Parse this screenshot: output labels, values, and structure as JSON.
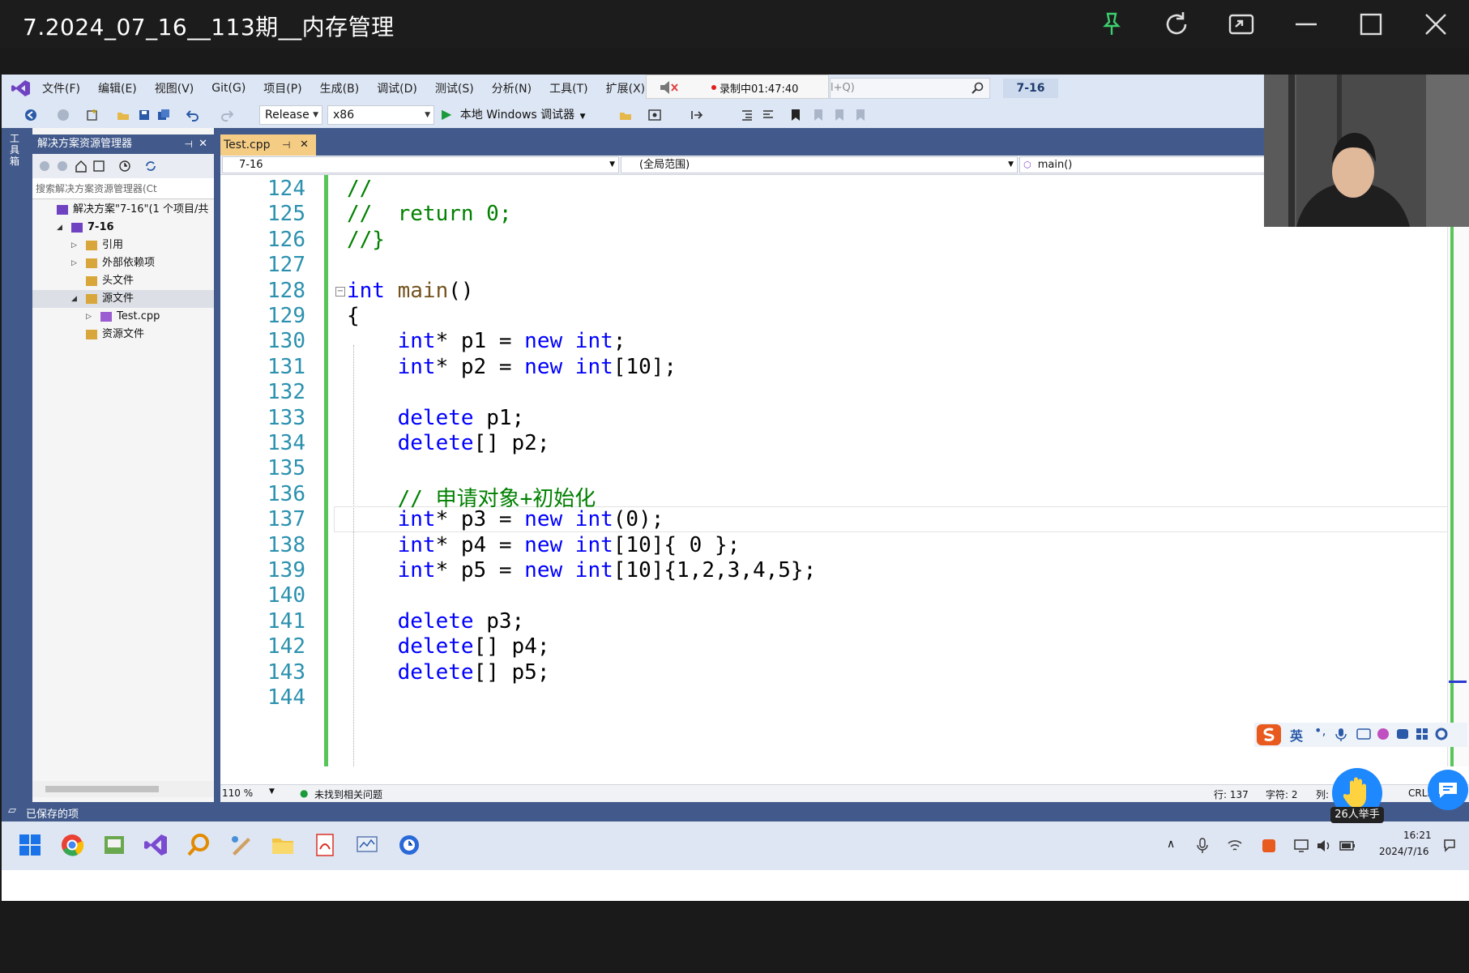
{
  "player": {
    "title": "7.2024_07_16__113期__内存管理"
  },
  "menu": {
    "items": [
      "文件(F)",
      "编辑(E)",
      "视图(V)",
      "Git(G)",
      "项目(P)",
      "生成(B)",
      "调试(D)",
      "测试(S)",
      "分析(N)",
      "工具(T)",
      "扩展(X)"
    ],
    "recording": "录制中01:47:40",
    "search_placeholder": "l+Q)",
    "project_badge": "7-16"
  },
  "toolbar": {
    "config": "Release",
    "platform": "x86",
    "run_label": "本地 Windows 调试器"
  },
  "left_strip": {
    "label": "工具箱"
  },
  "solution": {
    "header": "解决方案资源管理器",
    "search_placeholder": "搜索解决方案资源管理器(Ct",
    "tree": [
      {
        "label": "解决方案\"7-16\"(1 个项目/共",
        "level": 0,
        "expander": ""
      },
      {
        "label": "7-16",
        "level": 1,
        "expander": "◢"
      },
      {
        "label": "引用",
        "level": 2,
        "expander": "▷"
      },
      {
        "label": "外部依赖项",
        "level": 2,
        "expander": "▷"
      },
      {
        "label": "头文件",
        "level": 2,
        "expander": ""
      },
      {
        "label": "源文件",
        "level": 2,
        "expander": "◢"
      },
      {
        "label": "Test.cpp",
        "level": 3,
        "expander": "▷"
      },
      {
        "label": "资源文件",
        "level": 2,
        "expander": ""
      }
    ]
  },
  "editor": {
    "tab_label": "Test.cpp",
    "tab_pin": "⊣",
    "nav_project": "7-16",
    "nav_scope": "(全局范围)",
    "nav_member": "main()",
    "zoom": "110 %",
    "issues": "未找到相关问题",
    "row": "行: 137",
    "char": "字符: 2",
    "col": "列:",
    "eol": "CRLF"
  },
  "code": {
    "lines": [
      {
        "n": "124",
        "html": "<span class='cm'>//</span>"
      },
      {
        "n": "125",
        "html": "<span class='cm'>//  return 0;</span>"
      },
      {
        "n": "126",
        "html": "<span class='cm'>//}</span>"
      },
      {
        "n": "127",
        "html": ""
      },
      {
        "n": "128",
        "html": "<span class='kw'>int</span> <span class='fn'>main</span>()"
      },
      {
        "n": "129",
        "html": "{"
      },
      {
        "n": "130",
        "html": "    <span class='kw'>int</span>* p1 = <span class='kw'>new</span> <span class='kw'>int</span>;"
      },
      {
        "n": "131",
        "html": "    <span class='kw'>int</span>* p2 = <span class='kw'>new</span> <span class='kw'>int</span>[10];"
      },
      {
        "n": "132",
        "html": ""
      },
      {
        "n": "133",
        "html": "    <span class='kw'>delete</span> p1;"
      },
      {
        "n": "134",
        "html": "    <span class='kw'>delete</span>[] p2;"
      },
      {
        "n": "135",
        "html": ""
      },
      {
        "n": "136",
        "html": "    <span class='cm'>// 申请对象+初始化</span>"
      },
      {
        "n": "137",
        "html": "    <span class='kw'>int</span>* p3 = <span class='kw'>new</span> <span class='kw'>int</span>(0);"
      },
      {
        "n": "138",
        "html": "    <span class='kw'>int</span>* p4 = <span class='kw'>new</span> <span class='kw'>int</span>[10]{ 0 };"
      },
      {
        "n": "139",
        "html": "    <span class='kw'>int</span>* p5 = <span class='kw'>new</span> <span class='kw'>int</span>[10]{1,2,3,4,5};"
      },
      {
        "n": "140",
        "html": ""
      },
      {
        "n": "141",
        "html": "    <span class='kw'>delete</span> p3;"
      },
      {
        "n": "142",
        "html": "    <span class='kw'>delete</span>[] p4;"
      },
      {
        "n": "143",
        "html": "    <span class='kw'>delete</span>[] p5;"
      },
      {
        "n": "144",
        "html": ""
      }
    ]
  },
  "status": {
    "text": "已保存的项"
  },
  "tray": {
    "time": "16:21",
    "date": "2024/7/16",
    "ime": "英"
  },
  "classroom": {
    "raise_hand": "26人举手"
  }
}
